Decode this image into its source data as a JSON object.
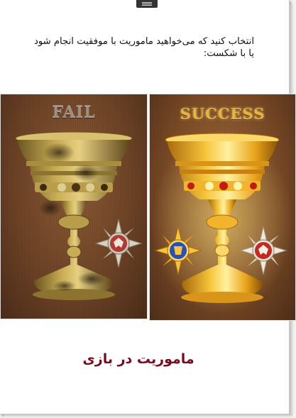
{
  "instruction": "انتخاب کنید که می‌خواهید ماموریت با موفقیت انجام شود یا با شکست:",
  "cards": {
    "fail": {
      "title": "FAIL"
    },
    "success": {
      "title": "SUCCESS"
    }
  },
  "caption": "ماموریت در بازی",
  "colors": {
    "caption": "#7a0b1e",
    "gold": "#e8b53a",
    "tarnished": "#9c8f80"
  },
  "icons": [
    "menu-icon",
    "goblet-icon",
    "red-eagle-emblem-icon",
    "blue-emblem-icon"
  ]
}
